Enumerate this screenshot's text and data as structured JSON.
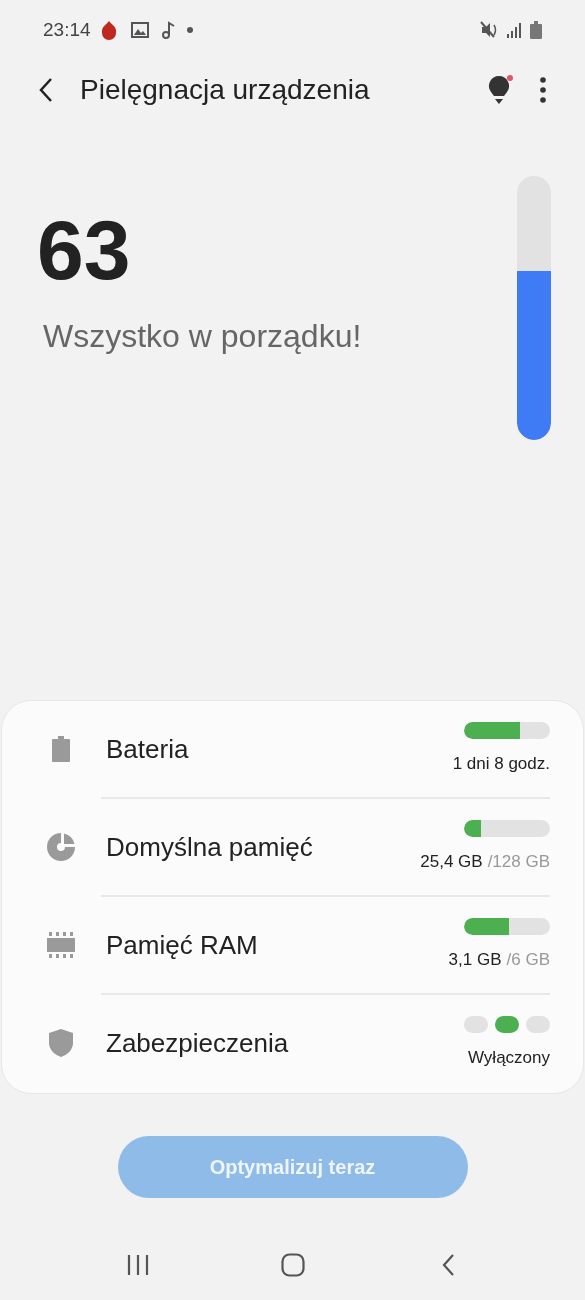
{
  "status_bar": {
    "time": "23:14"
  },
  "toolbar": {
    "title": "Pielęgnacja urządzenia",
    "tips_badge": true
  },
  "score": {
    "value": "63",
    "message": "Wszystko w porządku!",
    "level": 0.64
  },
  "items": [
    {
      "kind": "bar",
      "label": "Bateria",
      "level": 0.65,
      "value": "1 dni 8 godz."
    },
    {
      "kind": "bar",
      "label": "Domyślna pamięć",
      "level": 0.2,
      "value": "25,4 GB",
      "total": "/128 GB"
    },
    {
      "kind": "bar",
      "label": "Pamięć RAM",
      "level": 0.52,
      "value": "3,1 GB",
      "total": "/6 GB"
    },
    {
      "kind": "steps",
      "label": "Zabezpieczenia",
      "steps": [
        {
          "selected": false
        },
        {
          "selected": true
        },
        {
          "selected": false
        }
      ],
      "value": "Wyłączony"
    }
  ],
  "button": {
    "label": "Optymalizuj teraz",
    "disabled": true
  }
}
